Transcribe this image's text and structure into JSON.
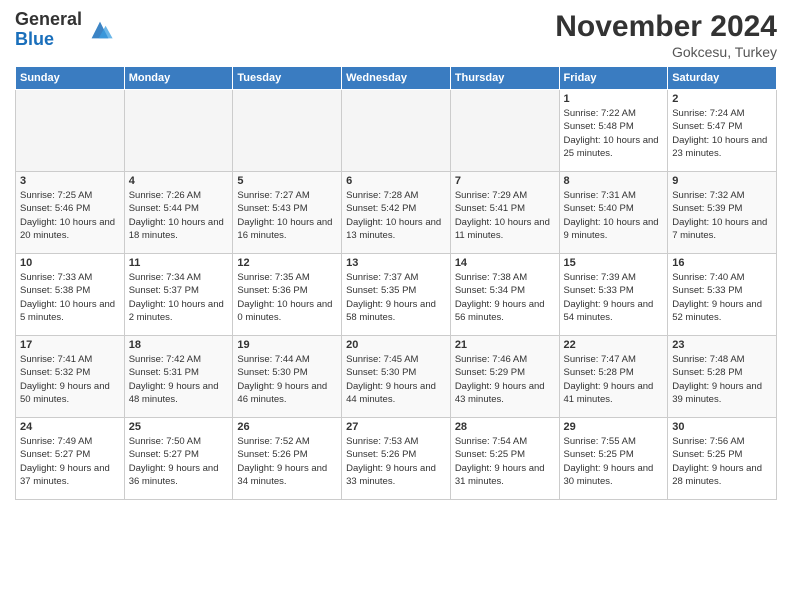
{
  "header": {
    "logo_general": "General",
    "logo_blue": "Blue",
    "month_title": "November 2024",
    "subtitle": "Gokcesu, Turkey"
  },
  "weekdays": [
    "Sunday",
    "Monday",
    "Tuesday",
    "Wednesday",
    "Thursday",
    "Friday",
    "Saturday"
  ],
  "weeks": [
    [
      {
        "day": "",
        "info": ""
      },
      {
        "day": "",
        "info": ""
      },
      {
        "day": "",
        "info": ""
      },
      {
        "day": "",
        "info": ""
      },
      {
        "day": "",
        "info": ""
      },
      {
        "day": "1",
        "info": "Sunrise: 7:22 AM\nSunset: 5:48 PM\nDaylight: 10 hours and 25 minutes."
      },
      {
        "day": "2",
        "info": "Sunrise: 7:24 AM\nSunset: 5:47 PM\nDaylight: 10 hours and 23 minutes."
      }
    ],
    [
      {
        "day": "3",
        "info": "Sunrise: 7:25 AM\nSunset: 5:46 PM\nDaylight: 10 hours and 20 minutes."
      },
      {
        "day": "4",
        "info": "Sunrise: 7:26 AM\nSunset: 5:44 PM\nDaylight: 10 hours and 18 minutes."
      },
      {
        "day": "5",
        "info": "Sunrise: 7:27 AM\nSunset: 5:43 PM\nDaylight: 10 hours and 16 minutes."
      },
      {
        "day": "6",
        "info": "Sunrise: 7:28 AM\nSunset: 5:42 PM\nDaylight: 10 hours and 13 minutes."
      },
      {
        "day": "7",
        "info": "Sunrise: 7:29 AM\nSunset: 5:41 PM\nDaylight: 10 hours and 11 minutes."
      },
      {
        "day": "8",
        "info": "Sunrise: 7:31 AM\nSunset: 5:40 PM\nDaylight: 10 hours and 9 minutes."
      },
      {
        "day": "9",
        "info": "Sunrise: 7:32 AM\nSunset: 5:39 PM\nDaylight: 10 hours and 7 minutes."
      }
    ],
    [
      {
        "day": "10",
        "info": "Sunrise: 7:33 AM\nSunset: 5:38 PM\nDaylight: 10 hours and 5 minutes."
      },
      {
        "day": "11",
        "info": "Sunrise: 7:34 AM\nSunset: 5:37 PM\nDaylight: 10 hours and 2 minutes."
      },
      {
        "day": "12",
        "info": "Sunrise: 7:35 AM\nSunset: 5:36 PM\nDaylight: 10 hours and 0 minutes."
      },
      {
        "day": "13",
        "info": "Sunrise: 7:37 AM\nSunset: 5:35 PM\nDaylight: 9 hours and 58 minutes."
      },
      {
        "day": "14",
        "info": "Sunrise: 7:38 AM\nSunset: 5:34 PM\nDaylight: 9 hours and 56 minutes."
      },
      {
        "day": "15",
        "info": "Sunrise: 7:39 AM\nSunset: 5:33 PM\nDaylight: 9 hours and 54 minutes."
      },
      {
        "day": "16",
        "info": "Sunrise: 7:40 AM\nSunset: 5:33 PM\nDaylight: 9 hours and 52 minutes."
      }
    ],
    [
      {
        "day": "17",
        "info": "Sunrise: 7:41 AM\nSunset: 5:32 PM\nDaylight: 9 hours and 50 minutes."
      },
      {
        "day": "18",
        "info": "Sunrise: 7:42 AM\nSunset: 5:31 PM\nDaylight: 9 hours and 48 minutes."
      },
      {
        "day": "19",
        "info": "Sunrise: 7:44 AM\nSunset: 5:30 PM\nDaylight: 9 hours and 46 minutes."
      },
      {
        "day": "20",
        "info": "Sunrise: 7:45 AM\nSunset: 5:30 PM\nDaylight: 9 hours and 44 minutes."
      },
      {
        "day": "21",
        "info": "Sunrise: 7:46 AM\nSunset: 5:29 PM\nDaylight: 9 hours and 43 minutes."
      },
      {
        "day": "22",
        "info": "Sunrise: 7:47 AM\nSunset: 5:28 PM\nDaylight: 9 hours and 41 minutes."
      },
      {
        "day": "23",
        "info": "Sunrise: 7:48 AM\nSunset: 5:28 PM\nDaylight: 9 hours and 39 minutes."
      }
    ],
    [
      {
        "day": "24",
        "info": "Sunrise: 7:49 AM\nSunset: 5:27 PM\nDaylight: 9 hours and 37 minutes."
      },
      {
        "day": "25",
        "info": "Sunrise: 7:50 AM\nSunset: 5:27 PM\nDaylight: 9 hours and 36 minutes."
      },
      {
        "day": "26",
        "info": "Sunrise: 7:52 AM\nSunset: 5:26 PM\nDaylight: 9 hours and 34 minutes."
      },
      {
        "day": "27",
        "info": "Sunrise: 7:53 AM\nSunset: 5:26 PM\nDaylight: 9 hours and 33 minutes."
      },
      {
        "day": "28",
        "info": "Sunrise: 7:54 AM\nSunset: 5:25 PM\nDaylight: 9 hours and 31 minutes."
      },
      {
        "day": "29",
        "info": "Sunrise: 7:55 AM\nSunset: 5:25 PM\nDaylight: 9 hours and 30 minutes."
      },
      {
        "day": "30",
        "info": "Sunrise: 7:56 AM\nSunset: 5:25 PM\nDaylight: 9 hours and 28 minutes."
      }
    ]
  ]
}
